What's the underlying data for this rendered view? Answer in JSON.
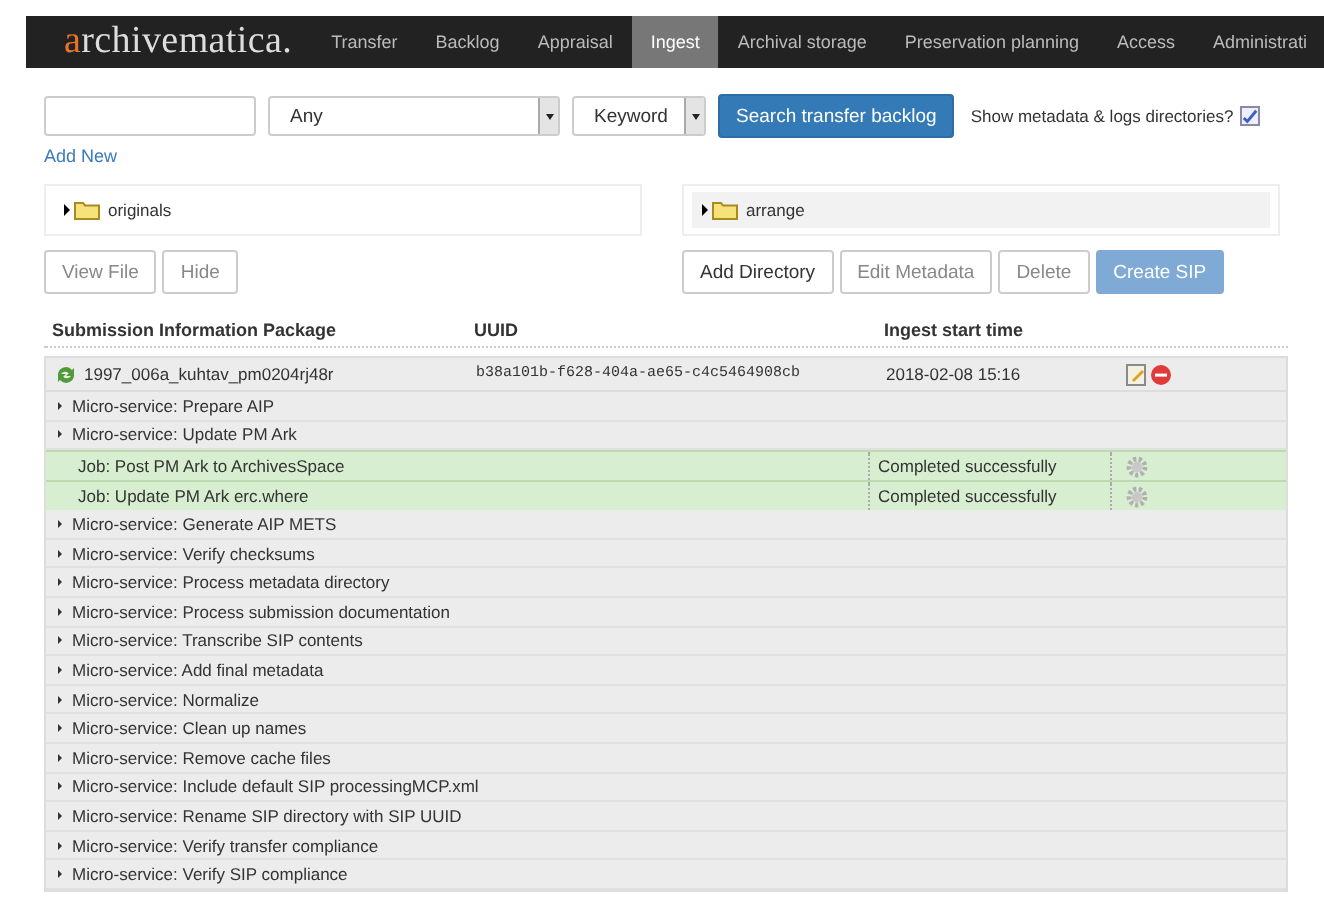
{
  "navbar": {
    "logo_initial": "a",
    "logo_rest": "rchivematica.",
    "tabs": [
      {
        "label": "Transfer",
        "selected": false
      },
      {
        "label": "Backlog",
        "selected": false
      },
      {
        "label": "Appraisal",
        "selected": false
      },
      {
        "label": "Ingest",
        "selected": true
      },
      {
        "label": "Archival storage",
        "selected": false
      },
      {
        "label": "Preservation planning",
        "selected": false
      },
      {
        "label": "Access",
        "selected": false
      },
      {
        "label": "Administrati",
        "selected": false
      }
    ]
  },
  "search": {
    "field_select": "Any",
    "type_select": "Keyword",
    "button": "Search transfer backlog",
    "checkbox_label": "Show metadata & logs directories?",
    "checked": true,
    "add_new": "Add New"
  },
  "left_tree": {
    "folder": "originals",
    "buttons": [
      {
        "label": "View File",
        "kind": "muted"
      },
      {
        "label": "Hide",
        "kind": "muted"
      }
    ]
  },
  "right_tree": {
    "folder": "arrange",
    "buttons": [
      {
        "label": "Add Directory",
        "kind": "default"
      },
      {
        "label": "Edit Metadata",
        "kind": "muted"
      },
      {
        "label": "Delete",
        "kind": "muted"
      },
      {
        "label": "Create SIP",
        "kind": "primary"
      }
    ]
  },
  "table": {
    "columns": [
      "Submission Information Package",
      "UUID",
      "Ingest start time"
    ],
    "sip": {
      "name": "1997_006a_kuhtav_pm0204rj48r",
      "uuid": "b38a101b-f628-404a-ae65-c4c5464908cb",
      "start": "2018-02-08 15:16"
    },
    "rows": [
      {
        "kind": "service",
        "label": "Micro-service: Prepare AIP"
      },
      {
        "kind": "service",
        "label": "Micro-service: Update PM Ark"
      },
      {
        "kind": "job",
        "label": "Job: Post PM Ark to ArchivesSpace",
        "status": "Completed successfully"
      },
      {
        "kind": "job",
        "label": "Job: Update PM Ark erc.where",
        "status": "Completed successfully"
      },
      {
        "kind": "service",
        "label": "Micro-service: Generate AIP METS"
      },
      {
        "kind": "service",
        "label": "Micro-service: Verify checksums"
      },
      {
        "kind": "service",
        "label": "Micro-service: Process metadata directory"
      },
      {
        "kind": "service",
        "label": "Micro-service: Process submission documentation"
      },
      {
        "kind": "service",
        "label": "Micro-service: Transcribe SIP contents"
      },
      {
        "kind": "service",
        "label": "Micro-service: Add final metadata"
      },
      {
        "kind": "service",
        "label": "Micro-service: Normalize"
      },
      {
        "kind": "service",
        "label": "Micro-service: Clean up names"
      },
      {
        "kind": "service",
        "label": "Micro-service: Remove cache files"
      },
      {
        "kind": "service",
        "label": "Micro-service: Include default SIP processingMCP.xml"
      },
      {
        "kind": "service",
        "label": "Micro-service: Rename SIP directory with SIP UUID"
      },
      {
        "kind": "service",
        "label": "Micro-service: Verify transfer compliance"
      },
      {
        "kind": "service",
        "label": "Micro-service: Verify SIP compliance"
      }
    ]
  }
}
